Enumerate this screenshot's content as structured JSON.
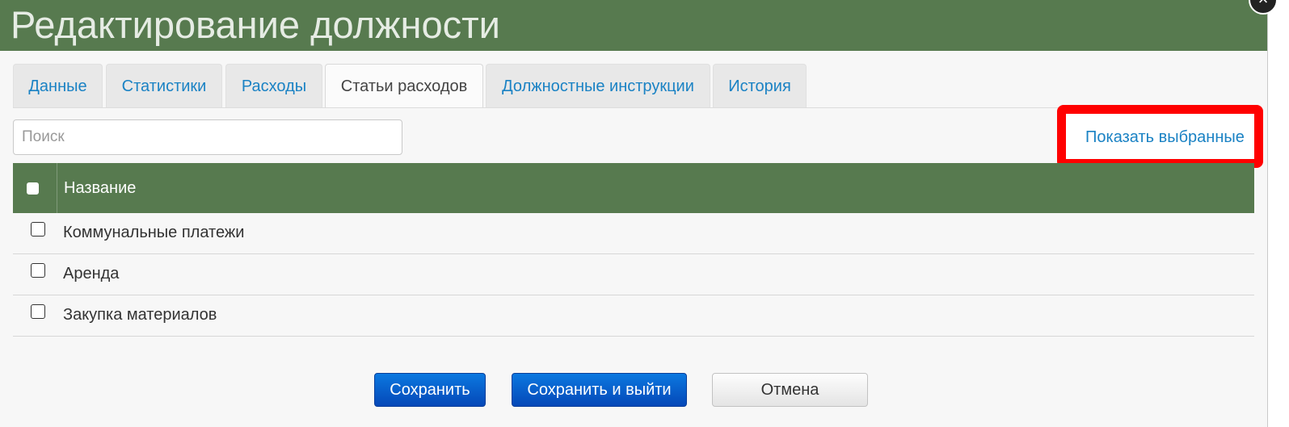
{
  "dialog": {
    "title": "Редактирование должности",
    "close_icon": "close-icon"
  },
  "tabs": [
    {
      "label": "Данные",
      "active": false
    },
    {
      "label": "Статистики",
      "active": false
    },
    {
      "label": "Расходы",
      "active": false
    },
    {
      "label": "Статьи расходов",
      "active": true
    },
    {
      "label": "Должностные инструкции",
      "active": false
    },
    {
      "label": "История",
      "active": false
    }
  ],
  "search": {
    "placeholder": "Поиск",
    "value": ""
  },
  "show_selected_label": "Показать выбранные",
  "grid": {
    "column_header": "Название",
    "rows": [
      {
        "label": "Коммунальные платежи",
        "checked": false
      },
      {
        "label": "Аренда",
        "checked": false
      },
      {
        "label": "Закупка материалов",
        "checked": false
      }
    ]
  },
  "buttons": {
    "save": "Сохранить",
    "save_exit": "Сохранить и выйти",
    "cancel": "Отмена"
  },
  "colors": {
    "header_green": "#577a4f",
    "link_blue": "#1a82c4",
    "highlight_red": "#ff0000",
    "primary_blue": "#0548b8"
  }
}
